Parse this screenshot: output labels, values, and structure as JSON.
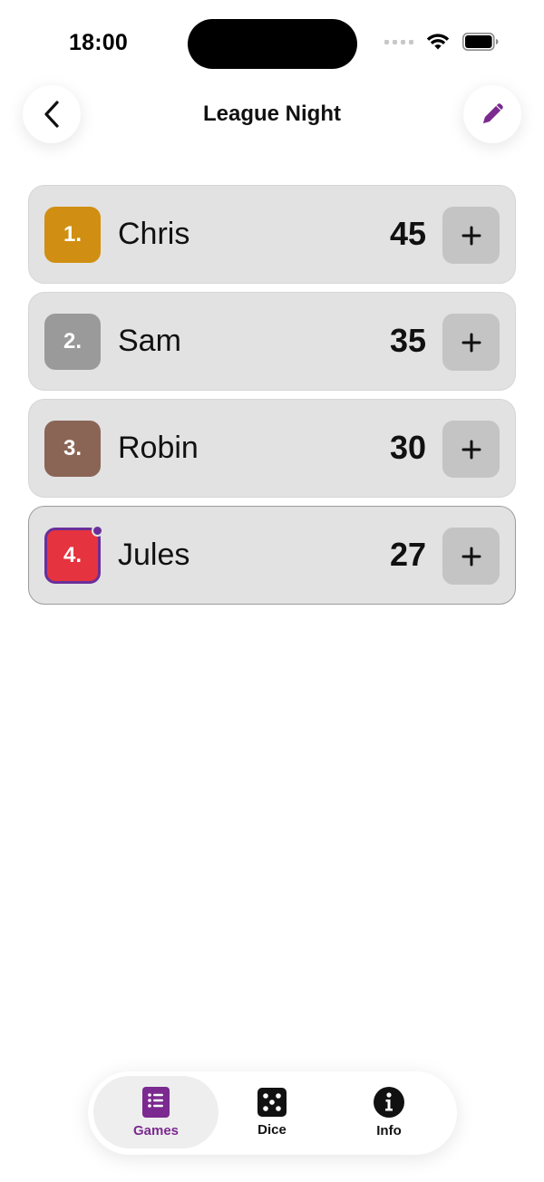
{
  "status": {
    "time": "18:00"
  },
  "header": {
    "title": "League Night"
  },
  "colors": {
    "accent": "#7b2a8f",
    "active_outline": "#6a2f9a"
  },
  "players": [
    {
      "rank": "1.",
      "name": "Chris",
      "score": "45",
      "badge_color": "#d08f12",
      "active": false
    },
    {
      "rank": "2.",
      "name": "Sam",
      "score": "35",
      "badge_color": "#9a9a9a",
      "active": false
    },
    {
      "rank": "3.",
      "name": "Robin",
      "score": "30",
      "badge_color": "#8a6556",
      "active": false
    },
    {
      "rank": "4.",
      "name": "Jules",
      "score": "27",
      "badge_color": "#e5333f",
      "active": true
    }
  ],
  "tabs": [
    {
      "label": "Games",
      "icon": "list-icon",
      "selected": true
    },
    {
      "label": "Dice",
      "icon": "dice-icon",
      "selected": false
    },
    {
      "label": "Info",
      "icon": "info-icon",
      "selected": false
    }
  ]
}
